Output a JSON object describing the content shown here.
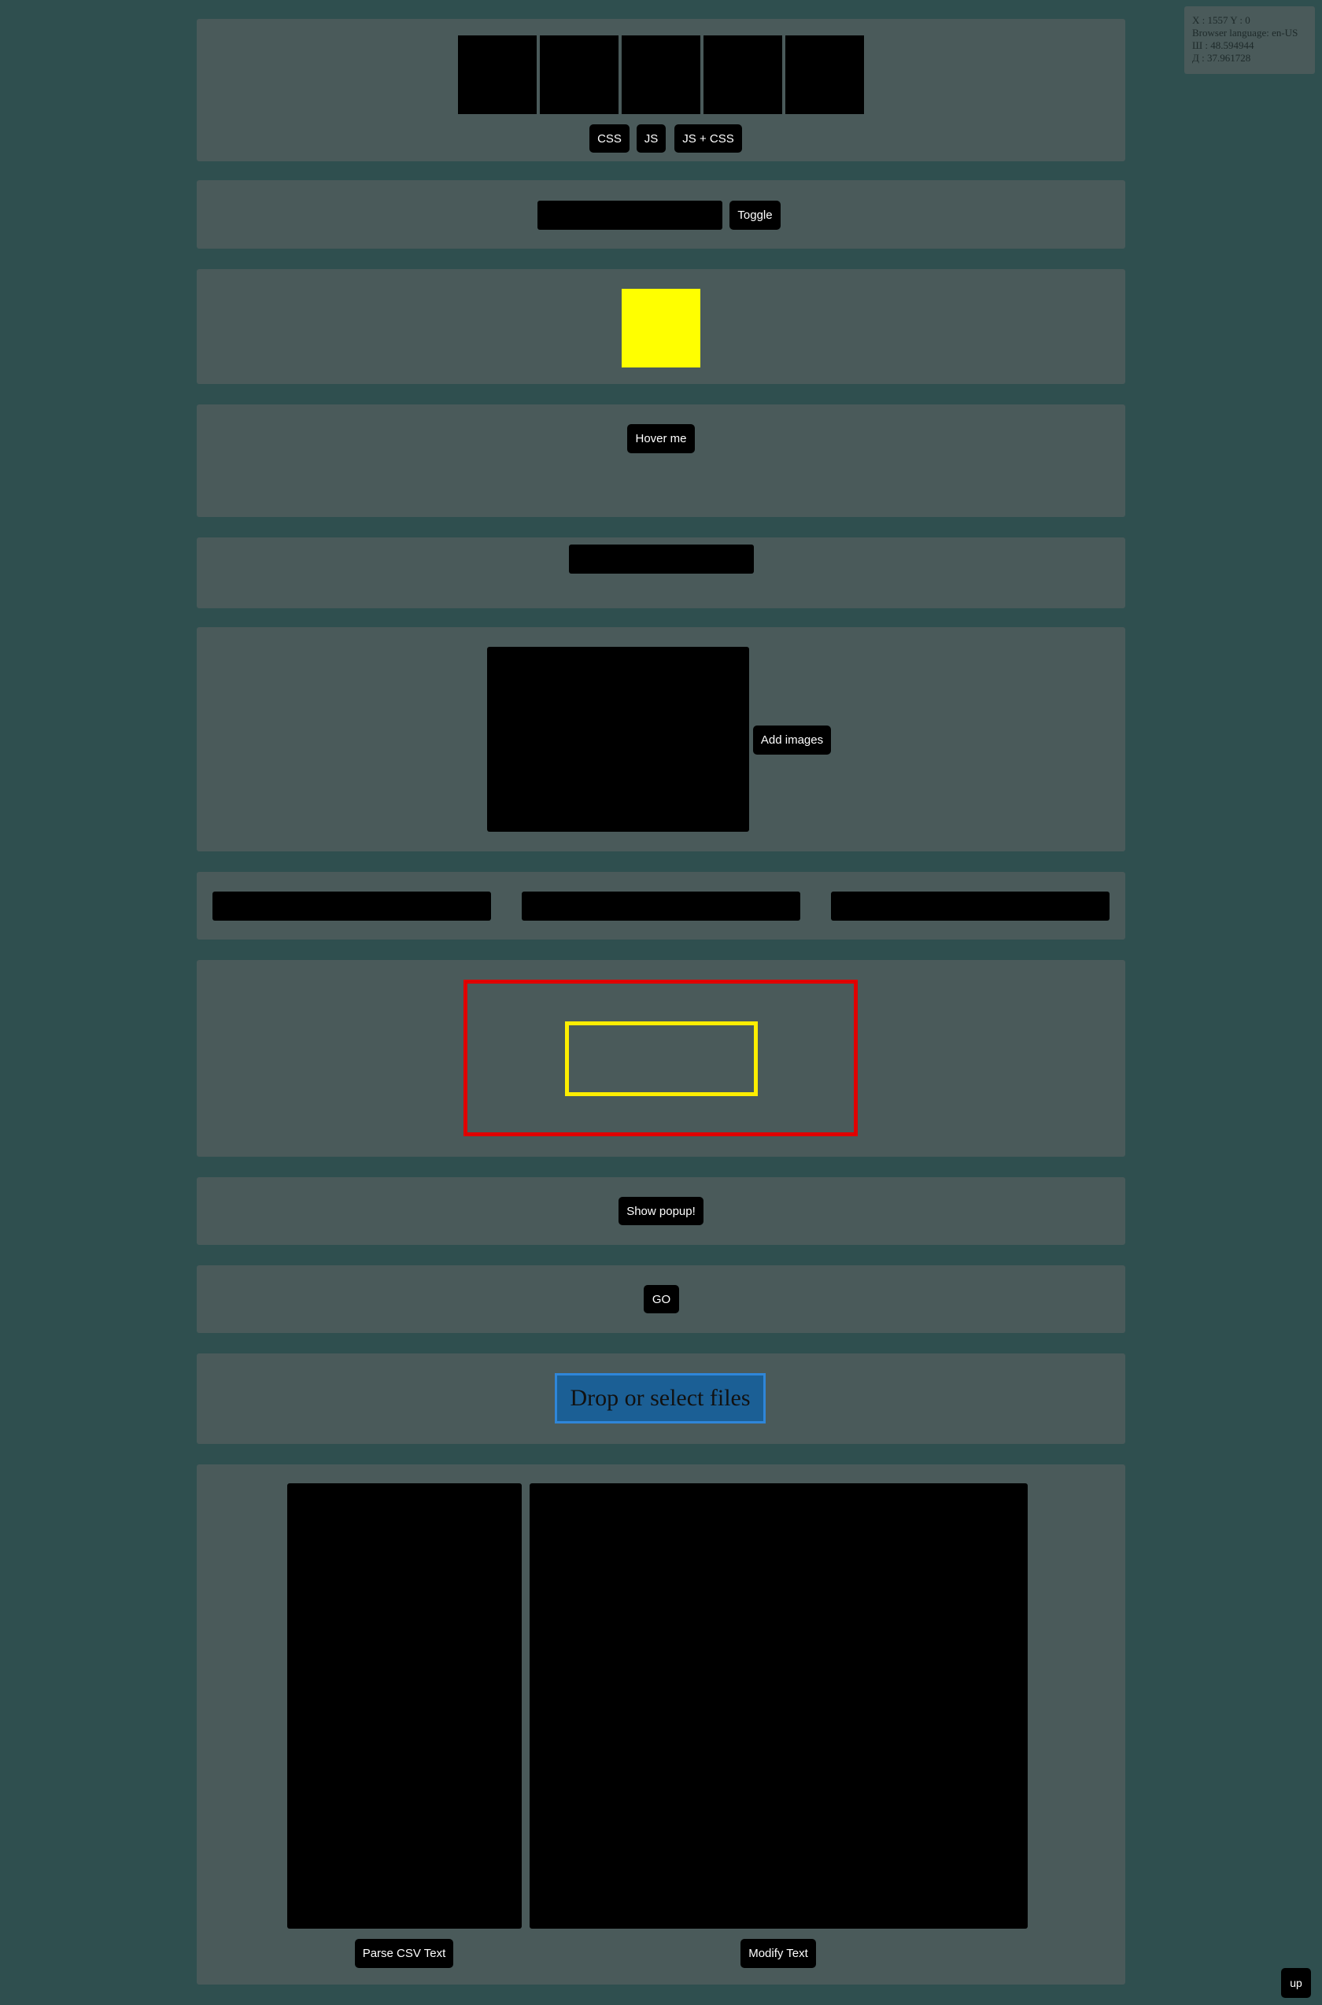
{
  "info": {
    "coords": "X : 1557 Y : 0",
    "language": "Browser language: en-US",
    "latitude": "Ш : 48.594944",
    "longitude": "Д : 37.961728"
  },
  "slider": {
    "css_label": "CSS",
    "js_label": "JS",
    "jscss_label": "JS + CSS"
  },
  "toggle": {
    "label": "Toggle"
  },
  "hover": {
    "label": "Hover me"
  },
  "gallery": {
    "add_label": "Add images"
  },
  "popup": {
    "label": "Show popup!"
  },
  "go": {
    "label": "GO"
  },
  "dropzone": {
    "label": "Drop or select files"
  },
  "csv": {
    "parse_label": "Parse CSV Text",
    "modify_label": "Modify Text"
  },
  "up": {
    "label": "up"
  },
  "colors": {
    "background": "#2f4f4f",
    "panel": "#4a5a5a",
    "yellow_square": "#ffff00",
    "outer_frame": "#e00000",
    "inner_frame": "#ffee00",
    "dropzone": "#1b5f95"
  }
}
